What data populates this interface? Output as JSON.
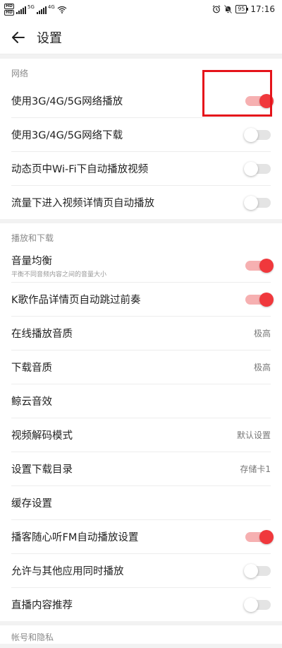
{
  "status_bar": {
    "time": "17:16",
    "battery": "95",
    "net1": "5G",
    "net2": "4G"
  },
  "header": {
    "title": "设置"
  },
  "sections": [
    {
      "header": "网络",
      "rows": [
        {
          "label": "使用3G/4G/5G网络播放",
          "toggle": "on"
        },
        {
          "label": "使用3G/4G/5G网络下载",
          "toggle": "off"
        },
        {
          "label": "动态页中Wi-Fi下自动播放视频",
          "toggle": "off"
        },
        {
          "label": "流量下进入视频详情页自动播放",
          "toggle": "off"
        }
      ]
    },
    {
      "header": "播放和下载",
      "rows": [
        {
          "label": "音量均衡",
          "sub": "平衡不同音频内容之间的音量大小",
          "toggle": "on"
        },
        {
          "label": "K歌作品详情页自动跳过前奏",
          "toggle": "on"
        },
        {
          "label": "在线播放音质",
          "value": "极高"
        },
        {
          "label": "下载音质",
          "value": "极高"
        },
        {
          "label": "鲸云音效"
        },
        {
          "label": "视频解码模式",
          "value": "默认设置"
        },
        {
          "label": "设置下载目录",
          "value": "存储卡1"
        },
        {
          "label": "缓存设置"
        },
        {
          "label": "播客随心听FM自动播放设置",
          "toggle": "on"
        },
        {
          "label": "允许与其他应用同时播放",
          "toggle": "off"
        },
        {
          "label": "直播内容推荐",
          "toggle": "off"
        }
      ]
    }
  ],
  "bottom_section": {
    "header": "帐号和隐私"
  },
  "colors": {
    "accent": "#f0383c",
    "highlight": "#e5141b"
  }
}
